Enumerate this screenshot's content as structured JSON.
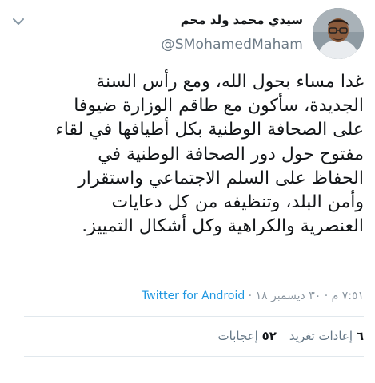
{
  "tweet": {
    "author": {
      "display_name": "سيدي محمد ولد محم",
      "handle": "@SMohamedMaham"
    },
    "text_lines": [
      "غدا مساء بحول الله، ومع رأس السنة",
      "الجديدة، سأكون مع طاقم الوزارة ضيوفا",
      "على الصحافة الوطنية بكل أطيافها في لقاء",
      "مفتوح حول دور الصحافة الوطنية في",
      "الحفاظ على السلم الاجتماعي واستقرار",
      "وأمن البلد، وتنظيفه من كل دعايات",
      "العنصرية والكراهية وكل أشكال التمييز."
    ],
    "timestamp": "٧:٥١ م · ٣٠ ديسمبر ١٨ ·",
    "source": "Twitter for Android",
    "retweets": {
      "count": "٦",
      "label": "إعادات تغريد"
    },
    "likes": {
      "count": "٥٢",
      "label": "إعجابات"
    }
  },
  "icons": {
    "menu": "chevron-down-icon",
    "avatar": "avatar-photo"
  },
  "colors": {
    "text": "#14171a",
    "secondary": "#657786",
    "link": "#1b95e0",
    "divider": "#e1e8ed"
  }
}
